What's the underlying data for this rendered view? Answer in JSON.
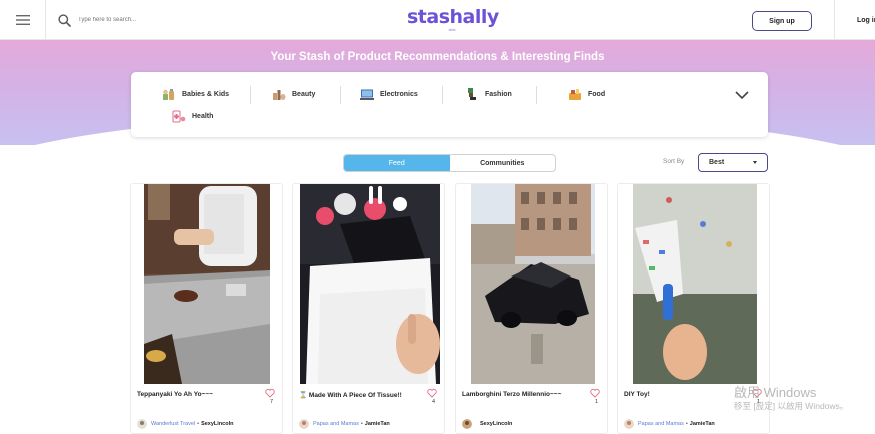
{
  "header": {
    "search_placeholder": "Type here to search...",
    "logo_text": "stashally",
    "logo_beta": "beta",
    "signup_label": "Sign up",
    "login_label": "Log in"
  },
  "hero": {
    "title": "Your Stash of Product Recommendations & Interesting Finds"
  },
  "categories": [
    {
      "label": "Babies & Kids",
      "icon": "baby-items-icon"
    },
    {
      "label": "Beauty",
      "icon": "beauty-icon"
    },
    {
      "label": "Electronics",
      "icon": "laptop-icon"
    },
    {
      "label": "Fashion",
      "icon": "fashion-icon"
    },
    {
      "label": "Food",
      "icon": "food-icon"
    },
    {
      "label": "Health",
      "icon": "health-icon"
    }
  ],
  "tabs": [
    {
      "label": "Feed",
      "active": true
    },
    {
      "label": "Communities",
      "active": false
    }
  ],
  "sort": {
    "label": "Sort By",
    "selected": "Best"
  },
  "cards": [
    {
      "title": "Teppanyaki Yo Ah Yo~~~",
      "likes": "7",
      "community": "Wanderlust Travel",
      "sep": "•",
      "user": "SexyLincoln"
    },
    {
      "title": "Made With A Piece Of Tissue!!",
      "likes": "4",
      "community": "Papas and Mamas",
      "sep": "•",
      "user": "JamieTan"
    },
    {
      "title": "Lamborghini Terzo Millennio~~~",
      "likes": "1",
      "community": "",
      "sep": "",
      "user": "SexyLincoln"
    },
    {
      "title": "DIY Toy!",
      "likes": "1",
      "community": "Papas and Mamas",
      "sep": "•",
      "user": "JamieTan"
    }
  ],
  "watermark": {
    "line1": "啟用 Windows",
    "line2": "移至 [設定] 以啟用 Windows。"
  },
  "colors": {
    "brand": "#6b52d6",
    "tab_active": "#55b6ec",
    "heart": "#e8758f",
    "community_link": "#5a7bd8"
  }
}
